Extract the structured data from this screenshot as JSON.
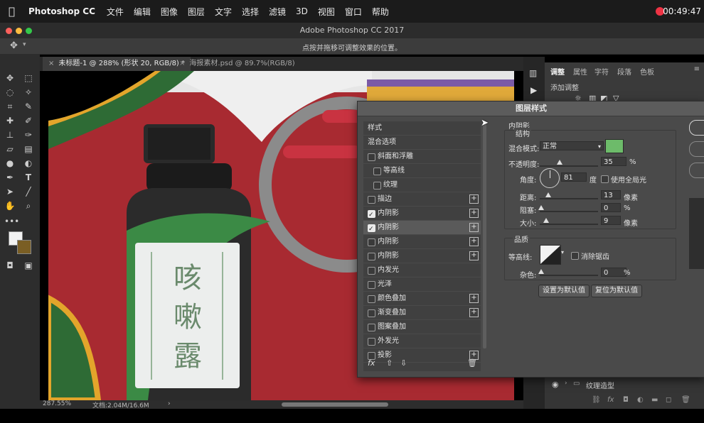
{
  "menubar": {
    "app_name": "Photoshop CC",
    "items": [
      "文件",
      "编辑",
      "图像",
      "图层",
      "文字",
      "选择",
      "滤镜",
      "3D",
      "视图",
      "窗口",
      "帮助"
    ],
    "clock": "00:49:47"
  },
  "window": {
    "title": "Adobe Photoshop CC 2017"
  },
  "options_bar": {
    "hint": "点按并拖移可调整效果的位置。"
  },
  "tabs": [
    {
      "label": "未标题-1 @ 288% (形状 20, RGB/8) *"
    },
    {
      "label": "海报素材.psd @ 89.7%(RGB/8)"
    }
  ],
  "canvas_art": {
    "label_chars": [
      "咳",
      "嗽",
      "露"
    ]
  },
  "status": {
    "zoom": "287.55%",
    "doc": "文档:2.04M/16.6M"
  },
  "panel": {
    "tabs": [
      "调整",
      "属性",
      "字符",
      "段落",
      "色板"
    ],
    "add_adjustment": "添加调整",
    "layer_name": "纹理造型"
  },
  "dialog": {
    "title": "图层样式",
    "list_header": "样式",
    "blend_options": "混合选项",
    "items": [
      {
        "label": "斜面和浮雕",
        "checked": false,
        "indent": false,
        "plus": false
      },
      {
        "label": "等高线",
        "checked": false,
        "indent": true,
        "plus": false
      },
      {
        "label": "纹理",
        "checked": false,
        "indent": true,
        "plus": false
      },
      {
        "label": "描边",
        "checked": false,
        "indent": false,
        "plus": true
      },
      {
        "label": "内阴影",
        "checked": true,
        "indent": false,
        "plus": true
      },
      {
        "label": "内阴影",
        "checked": true,
        "indent": false,
        "plus": true,
        "selected": true
      },
      {
        "label": "内阴影",
        "checked": false,
        "indent": false,
        "plus": true
      },
      {
        "label": "内阴影",
        "checked": false,
        "indent": false,
        "plus": true
      },
      {
        "label": "内发光",
        "checked": false,
        "indent": false,
        "plus": false
      },
      {
        "label": "光泽",
        "checked": false,
        "indent": false,
        "plus": false
      },
      {
        "label": "颜色叠加",
        "checked": false,
        "indent": false,
        "plus": true
      },
      {
        "label": "渐变叠加",
        "checked": false,
        "indent": false,
        "plus": true
      },
      {
        "label": "图案叠加",
        "checked": false,
        "indent": false,
        "plus": false
      },
      {
        "label": "外发光",
        "checked": false,
        "indent": false,
        "plus": false
      },
      {
        "label": "投影",
        "checked": false,
        "indent": false,
        "plus": true
      }
    ],
    "section_title": "内阴影",
    "structure": "结构",
    "blend_mode_label": "混合模式:",
    "blend_mode_value": "正常",
    "shadow_color": "#6dbb6a",
    "opacity_label": "不透明度:",
    "opacity_value": "35",
    "angle_label": "角度:",
    "angle_value": "81",
    "angle_unit": "度",
    "global_light_label": "使用全局光",
    "distance_label": "距离:",
    "distance_value": "13",
    "choke_label": "阻塞:",
    "choke_value": "0",
    "size_label": "大小:",
    "size_value": "9",
    "px_unit": "像素",
    "pct_unit": "%",
    "quality": "品质",
    "contour_label": "等高线:",
    "antialias_label": "消除锯齿",
    "noise_label": "杂色:",
    "noise_value": "0",
    "set_default": "设置为默认值",
    "reset_default": "复位为默认值"
  }
}
